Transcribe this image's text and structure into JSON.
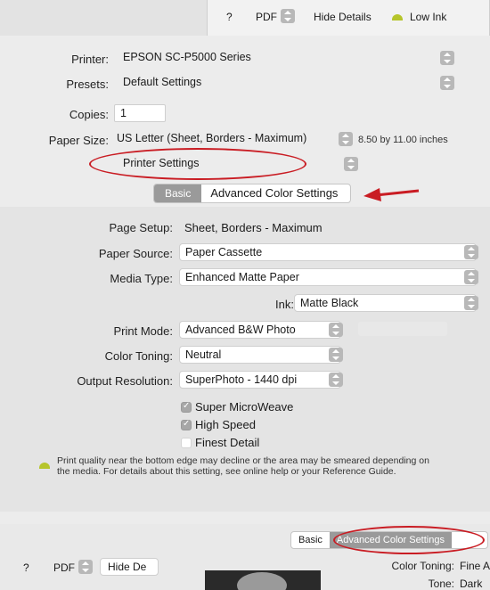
{
  "top_panel": {
    "help": "?",
    "pdf": "PDF",
    "hide_details": "Hide Details",
    "low_ink": "Low Ink"
  },
  "form": {
    "printer_label": "Printer:",
    "printer_value": "EPSON SC-P5000 Series",
    "presets_label": "Presets:",
    "presets_value": "Default Settings",
    "copies_label": "Copies:",
    "copies_value": "1",
    "paper_size_label": "Paper Size:",
    "paper_size_value": "US Letter (Sheet, Borders - Maximum)",
    "paper_size_dims": "8.50 by 11.00 inches",
    "section_value": "Printer Settings"
  },
  "tabs": {
    "basic": "Basic",
    "advanced": "Advanced Color Settings"
  },
  "settings": {
    "page_setup_label": "Page Setup:",
    "page_setup_value": "Sheet, Borders - Maximum",
    "paper_source_label": "Paper Source:",
    "paper_source_value": "Paper Cassette",
    "media_type_label": "Media Type:",
    "media_type_value": "Enhanced Matte Paper",
    "ink_label": "Ink:",
    "ink_value": "Matte Black",
    "print_mode_label": "Print Mode:",
    "print_mode_value": "Advanced B&W Photo",
    "color_toning_label": "Color Toning:",
    "color_toning_value": "Neutral",
    "output_resolution_label": "Output Resolution:",
    "output_resolution_value": "SuperPhoto - 1440 dpi",
    "super_microweave": "Super MicroWeave",
    "high_speed": "High Speed",
    "finest_detail": "Finest Detail"
  },
  "warning": {
    "text": "Print quality near the bottom edge may decline or the area may be smeared depending on the media. For details about this setting, see online help or your Reference Guide."
  },
  "bottom_panel": {
    "basic": "Basic",
    "advanced": "Advanced Color Settings",
    "help": "?",
    "pdf": "PDF",
    "hide_details": "Hide De",
    "color_toning_label": "Color Toning:",
    "color_toning_value": "Fine A",
    "tone_label": "Tone:",
    "tone_value": "Dark"
  },
  "colors": {
    "annotation_red": "#c91c23",
    "ink_icon_green": "#b6c52b"
  }
}
